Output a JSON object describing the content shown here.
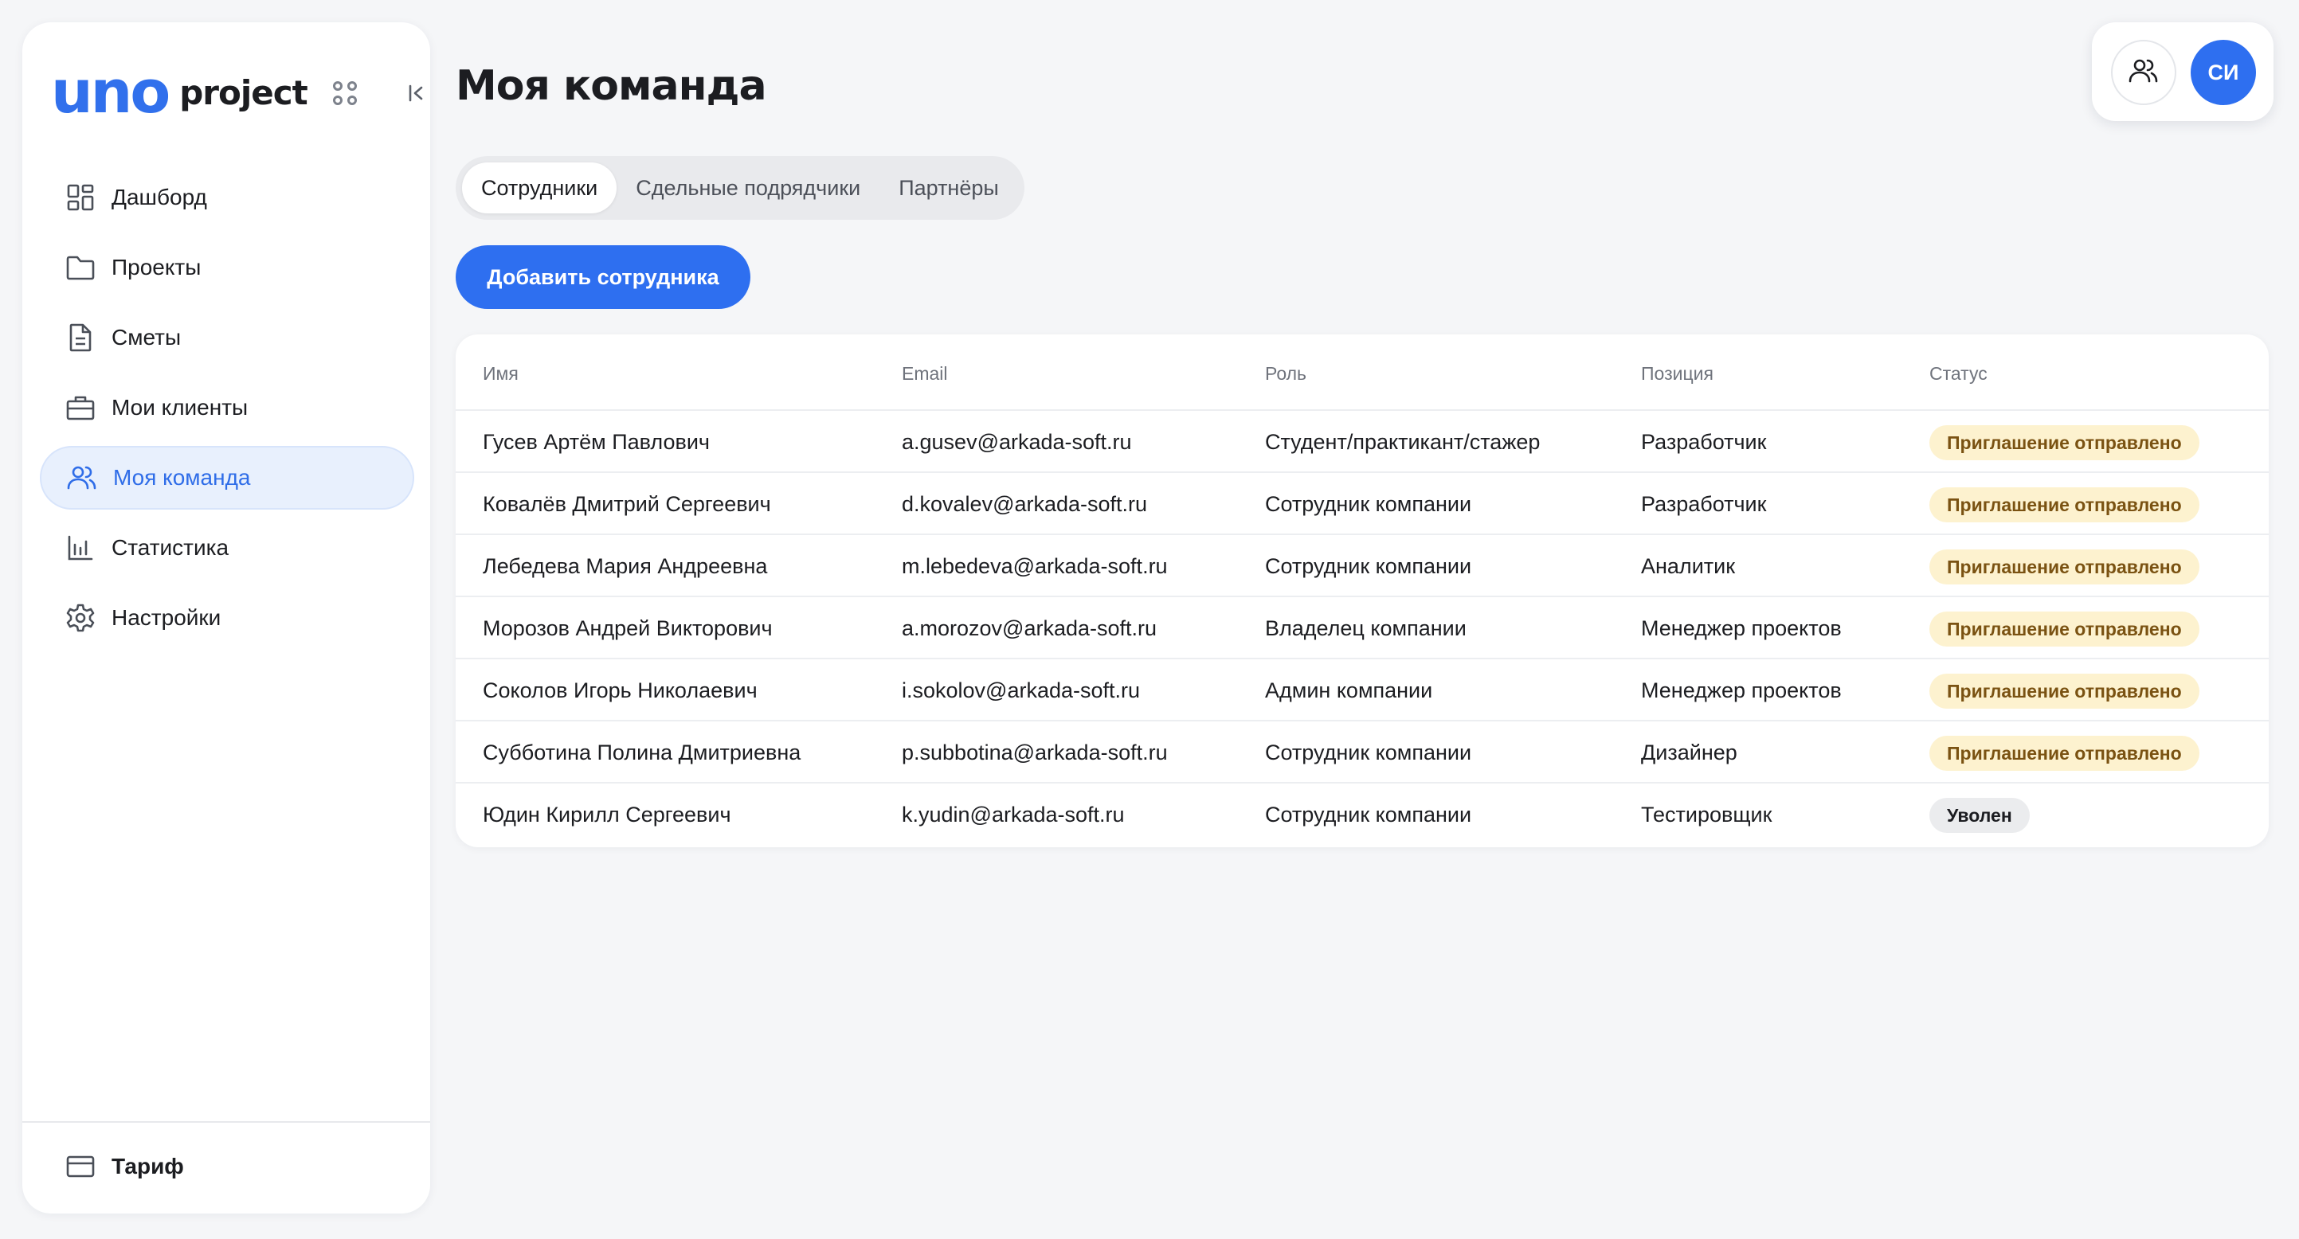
{
  "logo": {
    "brand": "uno",
    "product": "project"
  },
  "sidebar": {
    "items": [
      {
        "label": "Дашборд",
        "icon": "dashboard-icon",
        "active": false
      },
      {
        "label": "Проекты",
        "icon": "folder-icon",
        "active": false
      },
      {
        "label": "Сметы",
        "icon": "document-icon",
        "active": false
      },
      {
        "label": "Мои клиенты",
        "icon": "briefcase-icon",
        "active": false
      },
      {
        "label": "Моя команда",
        "icon": "users-icon",
        "active": true
      },
      {
        "label": "Статистика",
        "icon": "bar-chart-icon",
        "active": false
      },
      {
        "label": "Настройки",
        "icon": "gear-icon",
        "active": false
      }
    ],
    "footer": {
      "label": "Тариф",
      "icon": "credit-card-icon"
    }
  },
  "page": {
    "title": "Моя команда"
  },
  "tabs": [
    {
      "label": "Сотрудники",
      "active": true
    },
    {
      "label": "Сдельные подрядчики",
      "active": false
    },
    {
      "label": "Партнёры",
      "active": false
    }
  ],
  "add_button": "Добавить сотрудника",
  "header": {
    "avatar_initials": "СИ",
    "team_icon": "users-icon"
  },
  "table": {
    "columns": [
      "Имя",
      "Email",
      "Роль",
      "Позиция",
      "Статус"
    ],
    "rows": [
      [
        "Гусев Артём Павлович",
        "a.gusev@arkada-soft.ru",
        "Студент/практикант/стажер",
        "Разработчик",
        "Приглашение отправлено"
      ],
      [
        "Ковалёв Дмитрий Сергеевич",
        "d.kovalev@arkada-soft.ru",
        "Сотрудник компании",
        "Разработчик",
        "Приглашение отправлено"
      ],
      [
        "Лебедева Мария Андреевна",
        "m.lebedeva@arkada-soft.ru",
        "Сотрудник компании",
        "Аналитик",
        "Приглашение отправлено"
      ],
      [
        "Морозов Андрей Викторович",
        "a.morozov@arkada-soft.ru",
        "Владелец компании",
        "Менеджер проектов",
        "Приглашение отправлено"
      ],
      [
        "Соколов Игорь Николаевич",
        "i.sokolov@arkada-soft.ru",
        "Админ компании",
        "Менеджер проектов",
        "Приглашение отправлено"
      ],
      [
        "Субботина Полина Дмитриевна",
        "p.subbotina@arkada-soft.ru",
        "Сотрудник компании",
        "Дизайнер",
        "Приглашение отправлено"
      ],
      [
        "Юдин Кирилл Сергеевич",
        "k.yudin@arkada-soft.ru",
        "Сотрудник компании",
        "Тестировщик",
        "Уволен"
      ]
    ],
    "status_styles": {
      "Приглашение отправлено": "sent",
      "Уволен": "fired"
    }
  },
  "colors": {
    "accent": "#2e6ff0",
    "badge_pending_bg": "#fdf2cf",
    "badge_pending_text": "#7a5212",
    "badge_neutral_bg": "#ebecee"
  }
}
